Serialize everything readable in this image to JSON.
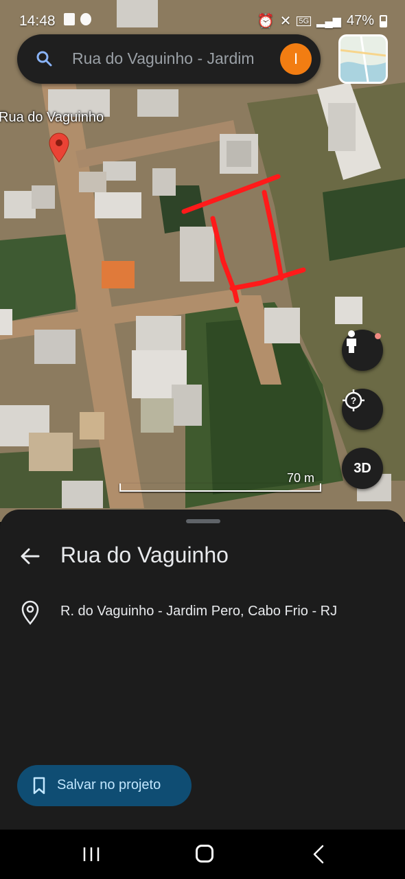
{
  "status_bar": {
    "time": "14:48",
    "network": "5G",
    "battery": "47%"
  },
  "search": {
    "query": "Rua do Vaguinho - Jardim",
    "avatar_letter": "I"
  },
  "map": {
    "street_label": "Rua do Vaguinho",
    "scale_label": "70 m",
    "btn_3d": "3D",
    "annotation_color": "#ff1a1a",
    "pin_color": "#ea4335"
  },
  "sheet": {
    "title": "Rua do Vaguinho",
    "address": "R. do Vaguinho - Jardim Pero, Cabo Frio - RJ",
    "save_label": "Salvar no projeto"
  },
  "colors": {
    "sheet_bg": "#1c1c1c",
    "save_bg": "#0f4d73",
    "save_text": "#c2e7ff",
    "avatar": "#f27d12"
  }
}
